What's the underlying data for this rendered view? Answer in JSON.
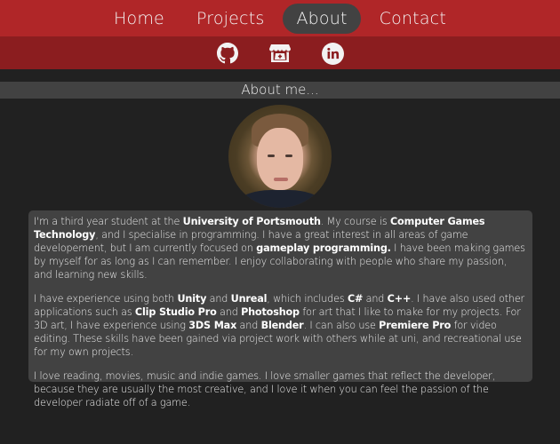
{
  "nav": {
    "items": [
      {
        "label": "Home",
        "active": false
      },
      {
        "label": "Projects",
        "active": false
      },
      {
        "label": "About",
        "active": true
      },
      {
        "label": "Contact",
        "active": false
      }
    ]
  },
  "social": [
    {
      "name": "GitHub",
      "icon": "github-icon"
    },
    {
      "name": "itch.io",
      "icon": "itchio-icon"
    },
    {
      "name": "LinkedIn",
      "icon": "linkedin-icon"
    }
  ],
  "section_title": "About me...",
  "about": {
    "p1": [
      {
        "t": "I'm a third year student at the ",
        "b": false
      },
      {
        "t": "University of Portsmouth",
        "b": true
      },
      {
        "t": ". My course is ",
        "b": false
      },
      {
        "t": "Computer Games Technology",
        "b": true
      },
      {
        "t": ", and I specialise in programming. I have a great interest in all areas of game developement, but I am currently focused on ",
        "b": false
      },
      {
        "t": "gameplay programming.",
        "b": true
      },
      {
        "t": " I have been making games by myself for as long as I can remember. I enjoy collaborating with people who share my passion, and learning new skills.",
        "b": false
      }
    ],
    "p2": [
      {
        "t": "I have experience using both ",
        "b": false
      },
      {
        "t": "Unity",
        "b": true
      },
      {
        "t": " and ",
        "b": false
      },
      {
        "t": "Unreal",
        "b": true
      },
      {
        "t": ", which includes ",
        "b": false
      },
      {
        "t": "C#",
        "b": true
      },
      {
        "t": " and ",
        "b": false
      },
      {
        "t": "C++",
        "b": true
      },
      {
        "t": ". I have also used other applications such as ",
        "b": false
      },
      {
        "t": "Clip Studio Pro",
        "b": true
      },
      {
        "t": " and ",
        "b": false
      },
      {
        "t": "Photoshop",
        "b": true
      },
      {
        "t": " for art that I like to make for my projects. For 3D art, I have experience using ",
        "b": false
      },
      {
        "t": "3DS Max",
        "b": true
      },
      {
        "t": " and ",
        "b": false
      },
      {
        "t": "Blender",
        "b": true
      },
      {
        "t": ". I can also use ",
        "b": false
      },
      {
        "t": "Premiere Pro",
        "b": true
      },
      {
        "t": " for video editing. These skills have been gained via project work with others while at uni, and recreational use for my own projects.",
        "b": false
      }
    ],
    "p3": [
      {
        "t": "I love reading, movies, music and indie games. I love smaller games that reflect the developer, because they are usually the most creative, and I love it when you can feel the passion of the developer radiate off of a game.",
        "b": false
      }
    ]
  },
  "colors": {
    "nav_bg": "#b02628",
    "social_bg": "#8b1d1f",
    "page_bg": "#212121",
    "panel_bg": "#424242"
  }
}
